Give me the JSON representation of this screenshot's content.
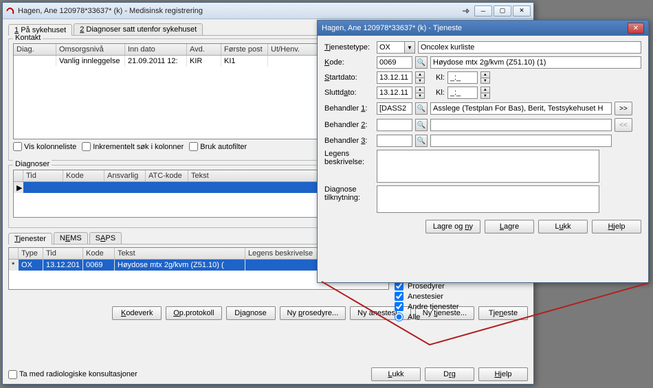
{
  "main": {
    "title": "Hagen, Ane 120978*33637* (k) - Medisinsk registrering",
    "tabs": [
      {
        "label": "1 På sykehuset"
      },
      {
        "label": "2 Diagnoser satt utenfor sykehuset"
      }
    ],
    "kontakt": {
      "title": "Kontakt",
      "columns": [
        "Diag.",
        "Omsorgsnivå",
        "Inn dato",
        "Avd.",
        "Første post",
        "Ut/Henv."
      ],
      "row": {
        "diag": "",
        "omsorg": "Vanlig innleggelse",
        "inn": "21.09.2011 12:",
        "avd": "KIR",
        "post": "KI1",
        "ut": ""
      },
      "checks": {
        "vis": "Vis kolonneliste",
        "inkr": "Inkrementelt søk i kolonner",
        "auto": "Bruk autofilter"
      }
    },
    "diagnoser": {
      "title": "Diagnoser",
      "columns": [
        "Tid",
        "Kode",
        "Ansvarlig",
        "ATC-kode",
        "Tekst"
      ]
    },
    "tjenester_tabs": [
      "Tjenester",
      "NEMS",
      "SAPS"
    ],
    "tjenester": {
      "columns": [
        "Type",
        "Tid",
        "Kode",
        "Tekst",
        "Legens beskrivelse"
      ],
      "row": {
        "type": "OX",
        "tid": "13.12.201",
        "kode": "0069",
        "tekst": "Høydose mtx 2g/kvm (Z51.10) (",
        "beskr": ""
      }
    },
    "filters": {
      "prosedyrer": "Prosedyrer",
      "anestesier": "Anestesier",
      "andre": "Andre tjenester",
      "alle": "Alle"
    },
    "buttons": {
      "kodeverk": "Kodeverk",
      "opprotokoll": "Op.protokoll",
      "diagnose": "Diagnose",
      "nyprosedyre": "Ny prosedyre...",
      "nyanestesi": "Ny anestesi...",
      "nytjeneste": "Ny tjeneste...",
      "tjeneste": "Tjeneste"
    },
    "bottom_check": "Ta med radiologiske konsultasjoner",
    "bottom_buttons": {
      "lukk": "Lukk",
      "drg": "Drg",
      "hjelp": "Hjelp"
    }
  },
  "dialog": {
    "title": "Hagen, Ane 120978*33637* (k) - Tjeneste",
    "tjenestetype": {
      "label": "Tjenestetype:",
      "value": "OX",
      "desc": "Oncolex kurliste"
    },
    "kode": {
      "label": "Kode:",
      "value": "0069",
      "desc": "Høydose mtx 2g/kvm (Z51.10) (1)"
    },
    "startdato": {
      "label": "Startdato:",
      "value": "13.12.11",
      "kl": "Kl:",
      "time": "_:_"
    },
    "sluttdato": {
      "label": "Sluttdato:",
      "value": "13.12.11",
      "kl": "Kl:",
      "time": "_:_"
    },
    "behandler1": {
      "label": "Behandler 1:",
      "value": "[DASS2",
      "desc": "Asslege (Testplan For Bas), Berit, Testsykehuset H"
    },
    "behandler2": {
      "label": "Behandler 2:",
      "value": "",
      "desc": ""
    },
    "behandler3": {
      "label": "Behandler 3:",
      "value": "",
      "desc": ""
    },
    "legens": {
      "label": "Legens beskrivelse:"
    },
    "diagnose": {
      "label": "Diagnose tilknytning:"
    },
    "buttons": {
      "lagreogny": "Lagre og ny",
      "lagre": "Lagre",
      "lukk": "Lukk",
      "hjelp": "Hjelp"
    },
    "more": ">>",
    "less": "<<"
  }
}
